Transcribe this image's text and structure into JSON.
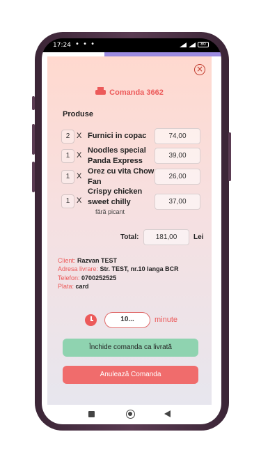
{
  "status": {
    "time": "17:24",
    "dots": "• • •",
    "battery": "80"
  },
  "order": {
    "title": "Comanda 3662",
    "products_label": "Produse",
    "items": [
      {
        "qty": "2",
        "x": "X",
        "name_line1": "Furnici in copac",
        "name_line2": "",
        "note": "",
        "price": "74,00"
      },
      {
        "qty": "1",
        "x": "X",
        "name_line1": "Noodles special",
        "name_line2": "Panda Express",
        "note": "",
        "price": "39,00"
      },
      {
        "qty": "1",
        "x": "X",
        "name_line1": "Orez cu vita Chow",
        "name_line2": "Fan",
        "note": "",
        "price": "26,00"
      },
      {
        "qty": "1",
        "x": "X",
        "name_line1": "Crispy chicken",
        "name_line2": "sweet chilly",
        "note": "fără picant",
        "price": "37,00"
      }
    ],
    "total_label": "Total:",
    "total_value": "181,00",
    "currency": "Lei"
  },
  "customer": {
    "client_key": "Client:",
    "client_value": "Razvan TEST",
    "address_key": "Adresa livrare:",
    "address_value": "Str. TEST, nr.10 langa BCR",
    "phone_key": "Telefon:",
    "phone_value": "0700252525",
    "payment_key": "Plata:",
    "payment_value": "card"
  },
  "delivery": {
    "minutes_value": "10...",
    "minutes_label": "minute"
  },
  "actions": {
    "delivered_label": "Închide comanda ca livrată",
    "cancel_label": "Anulează Comanda"
  },
  "colors": {
    "accent": "#ec5a5a",
    "success_button": "#8fd3b0",
    "cancel_button": "#f06c6c"
  }
}
